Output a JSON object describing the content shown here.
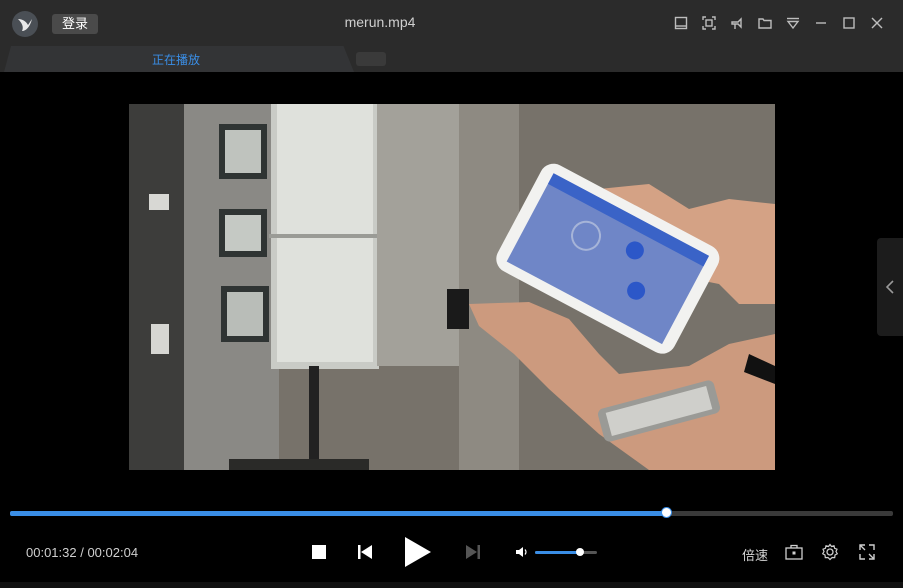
{
  "window": {
    "title": "merun.mp4",
    "login_label": "登录",
    "controls": [
      "mini-mode-icon",
      "screenshot-icon",
      "pin-icon",
      "folder-icon",
      "menu-icon",
      "minimize-icon",
      "maximize-icon",
      "close-icon"
    ]
  },
  "tabs": {
    "active_label": "正在播放"
  },
  "player": {
    "current_time": "00:01:32",
    "separator": " / ",
    "total_time": "00:02:04",
    "progress_fraction": 0.7427,
    "volume_fraction": 0.72,
    "speed_label": "倍速"
  },
  "colors": {
    "accent": "#3a8ee6",
    "background": "#000000",
    "titlebar": "#2b2b2b"
  }
}
